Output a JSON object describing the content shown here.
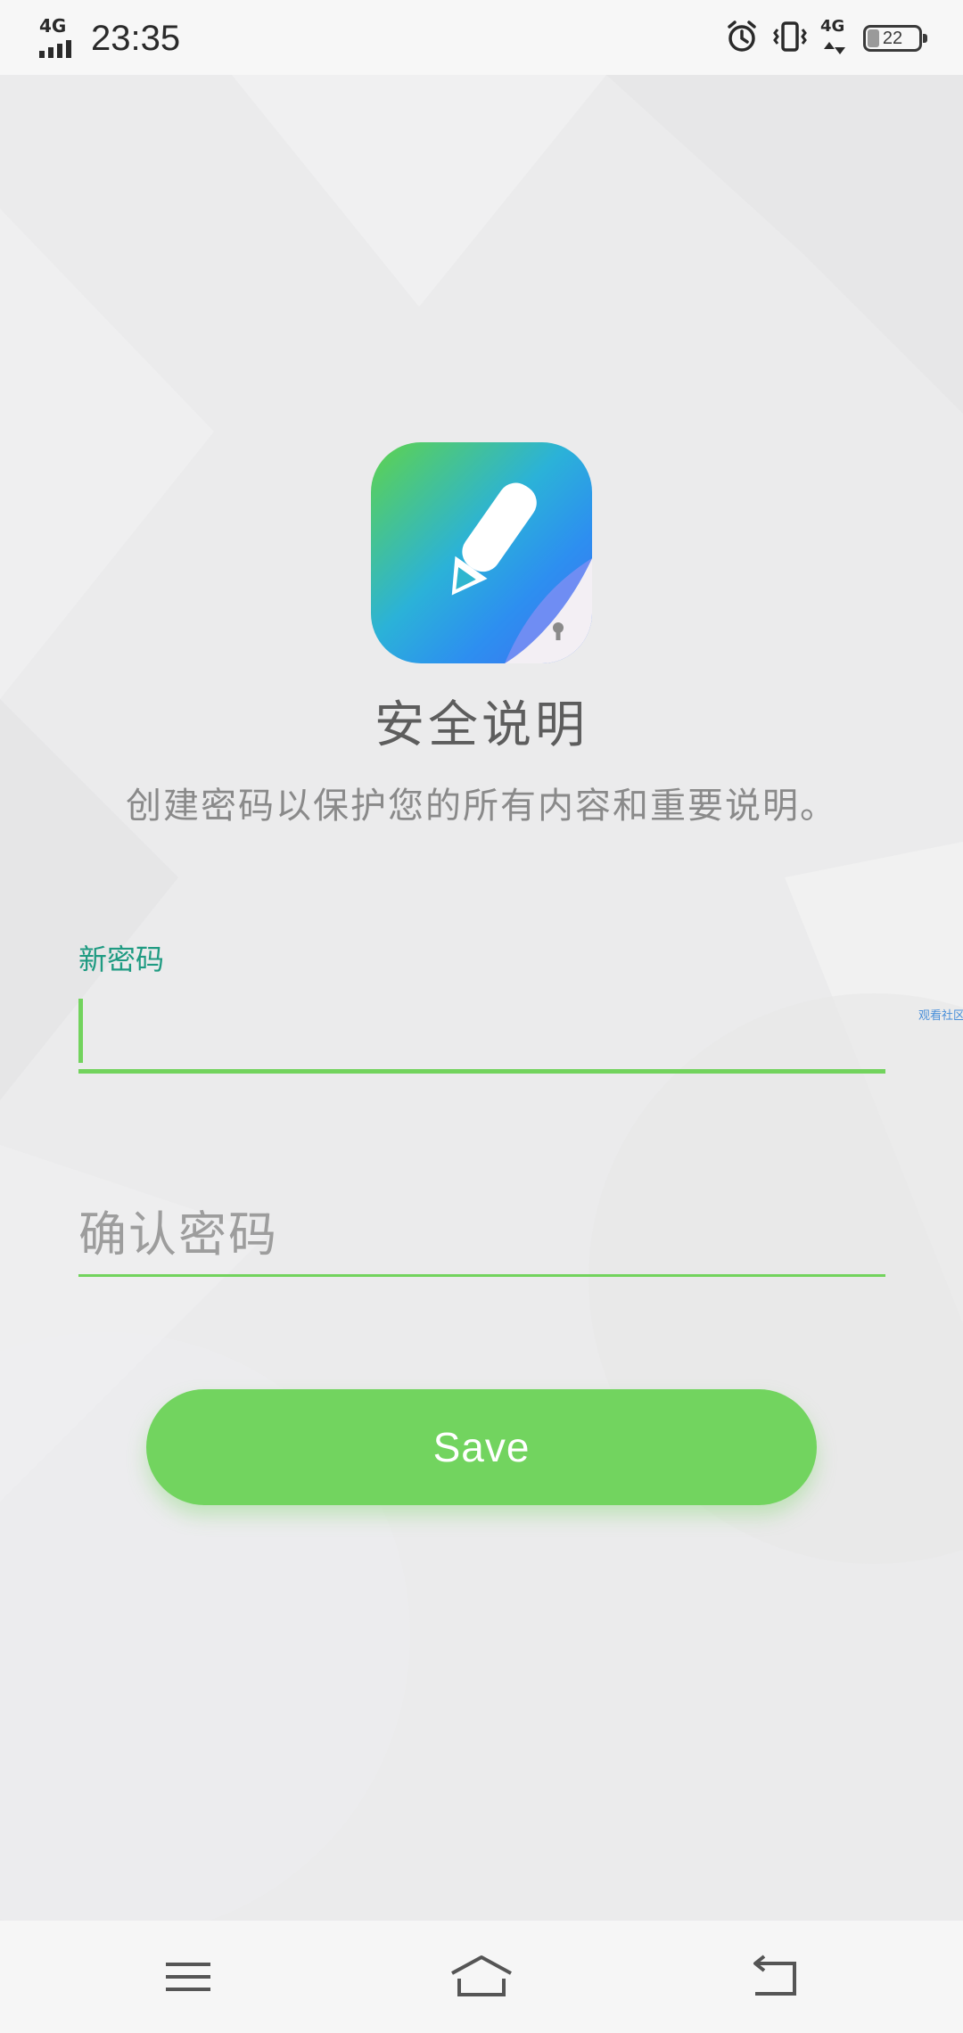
{
  "status_bar": {
    "network_left": "4G",
    "time": "23:35",
    "network_right": "4G",
    "battery_level": 22,
    "battery_label": "22",
    "icons": [
      "signal-icon",
      "alarm-icon",
      "vibrate-icon",
      "data-arrows-icon",
      "battery-icon"
    ]
  },
  "header": {
    "app_icon": "notes-pencil-icon",
    "title": "安全说明",
    "subtitle": "创建密码以保护您的所有内容和重要说明。"
  },
  "form": {
    "new_password_label": "新密码",
    "new_password_value": "",
    "confirm_password_placeholder": "确认密码",
    "confirm_password_value": ""
  },
  "save_button_label": "Save",
  "side_watermark": "观看社区",
  "colors": {
    "accent_green": "#72d45f",
    "label_teal": "#1f9b82",
    "background": "#ebebec"
  },
  "nav_bar": {
    "icons": [
      "menu-icon",
      "home-icon",
      "back-icon"
    ]
  }
}
